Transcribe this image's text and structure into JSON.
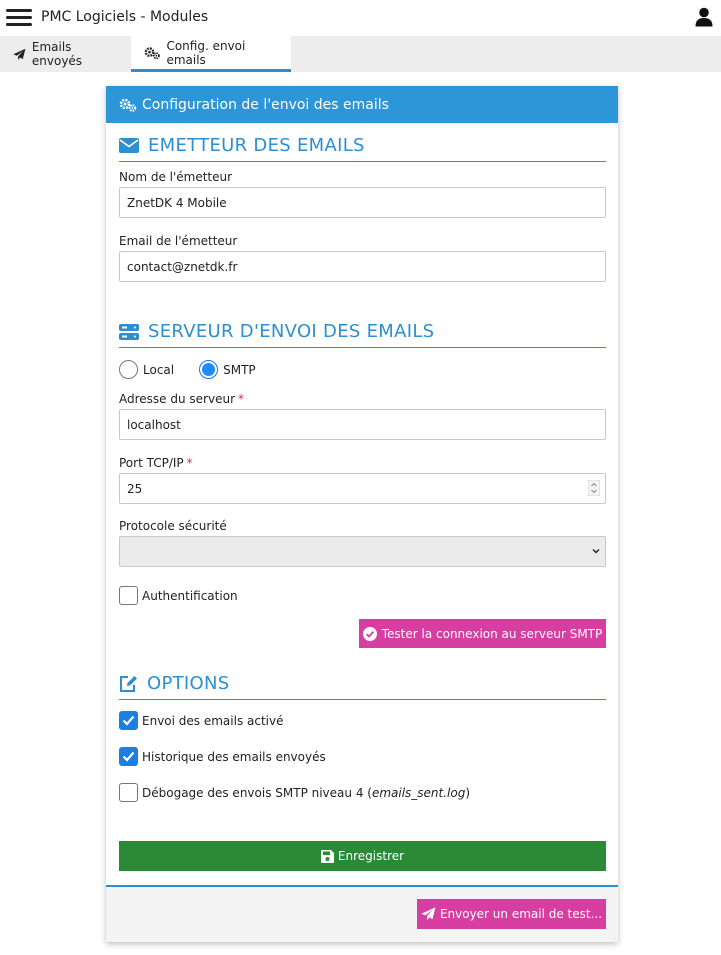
{
  "app": {
    "title": "PMC Logiciels - Modules"
  },
  "tabs": [
    {
      "label": "Emails envoyés",
      "icon": "paper-plane-icon"
    },
    {
      "label": "Config. envoi emails",
      "icon": "gears-icon"
    }
  ],
  "card": {
    "title": "Configuration de l'envoi des emails"
  },
  "sender": {
    "section_title": "EMETTEUR DES EMAILS",
    "name_label": "Nom de l'émetteur",
    "name_value": "ZnetDK 4 Mobile",
    "email_label": "Email de l'émetteur",
    "email_value": "contact@znetdk.fr"
  },
  "server": {
    "section_title": "SERVEUR D'ENVOI DES EMAILS",
    "radio_local": "Local",
    "radio_smtp": "SMTP",
    "selected": "SMTP",
    "address_label": "Adresse du serveur",
    "address_value": "localhost",
    "port_label": "Port TCP/IP",
    "port_value": "25",
    "required_mark": "*",
    "protocol_label": "Protocole sécurité",
    "protocol_value": "",
    "auth_label": "Authentification",
    "auth_checked": false,
    "test_button": "Tester la connexion au serveur SMTP"
  },
  "options": {
    "section_title": "OPTIONS",
    "enabled_label": "Envoi des emails activé",
    "history_label": "Historique des emails envoyés",
    "debug_label_prefix": "Débogage des envois SMTP niveau 4 (",
    "debug_label_file": "emails_sent.log",
    "debug_label_suffix": ")"
  },
  "actions": {
    "save_label": "Enregistrer",
    "send_test_label": "Envoyer un email de test..."
  },
  "colors": {
    "primary": "#2d96d8",
    "accent_pink": "#d63ea1",
    "save_green": "#2b8a36",
    "checkbox_blue": "#1a7fe0"
  }
}
